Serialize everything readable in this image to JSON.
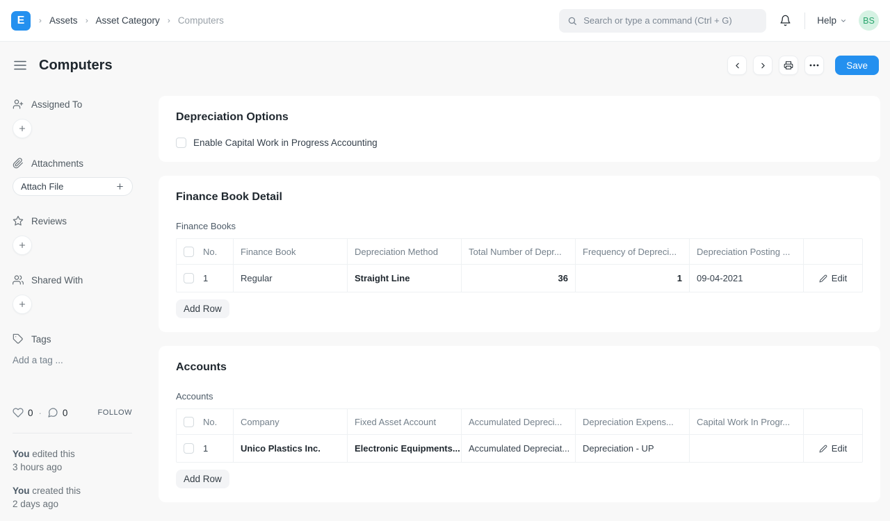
{
  "navbar": {
    "logo_letter": "E",
    "breadcrumbs": [
      "Assets",
      "Asset Category",
      "Computers"
    ],
    "search_placeholder": "Search or type a command (Ctrl + G)",
    "help_label": "Help",
    "avatar_initials": "BS"
  },
  "page_header": {
    "title": "Computers",
    "save_label": "Save"
  },
  "sidebar": {
    "assigned_to_label": "Assigned To",
    "attachments_label": "Attachments",
    "attach_file_label": "Attach File",
    "reviews_label": "Reviews",
    "shared_with_label": "Shared With",
    "tags_label": "Tags",
    "add_tag_placeholder": "Add a tag ...",
    "likes_count": "0",
    "comments_count": "0",
    "follow_label": "FOLLOW",
    "activity": [
      {
        "actor": "You",
        "action": "edited this",
        "time": "3 hours ago"
      },
      {
        "actor": "You",
        "action": "created this",
        "time": "2 days ago"
      }
    ]
  },
  "depreciation_options": {
    "title": "Depreciation Options",
    "checkbox_label": "Enable Capital Work in Progress Accounting"
  },
  "finance_book": {
    "title": "Finance Book Detail",
    "table_label": "Finance Books",
    "headers": [
      "No.",
      "Finance Book",
      "Depreciation Method",
      "Total Number of Depr...",
      "Frequency of Depreci...",
      "Depreciation Posting ..."
    ],
    "row": {
      "no": "1",
      "finance_book": "Regular",
      "depreciation_method": "Straight Line",
      "total_depreciations": "36",
      "frequency": "1",
      "posting_date": "09-04-2021"
    },
    "edit_label": "Edit",
    "add_row_label": "Add Row"
  },
  "accounts": {
    "title": "Accounts",
    "table_label": "Accounts",
    "headers": [
      "No.",
      "Company",
      "Fixed Asset Account",
      "Accumulated Depreci...",
      "Depreciation Expens...",
      "Capital Work In Progr..."
    ],
    "row": {
      "no": "1",
      "company": "Unico Plastics Inc.",
      "fixed_asset_account": "Electronic Equipments...",
      "accumulated_depreciation": "Accumulated Depreciat...",
      "depreciation_expense": "Depreciation - UP",
      "capital_wip": ""
    },
    "edit_label": "Edit",
    "add_row_label": "Add Row"
  },
  "icons": {
    "search": "magnifier",
    "bell": "notification-bell",
    "chevron_down": "caret",
    "hamburger": "sidebar-toggle",
    "prev": "chevron-left",
    "next": "chevron-right",
    "printer": "print",
    "ellipsis": "more-options",
    "user_plus": "assign-user",
    "paperclip": "attachment",
    "star": "review-star",
    "users": "shared-with",
    "tag": "tag-label",
    "heart": "like",
    "comment": "comment-bubble",
    "pencil": "edit"
  },
  "colors": {
    "brand_blue": "#2490ef",
    "avatar_bg": "#d5f2e3",
    "avatar_text": "#2aa56e",
    "page_bg": "#f8f8f8"
  }
}
